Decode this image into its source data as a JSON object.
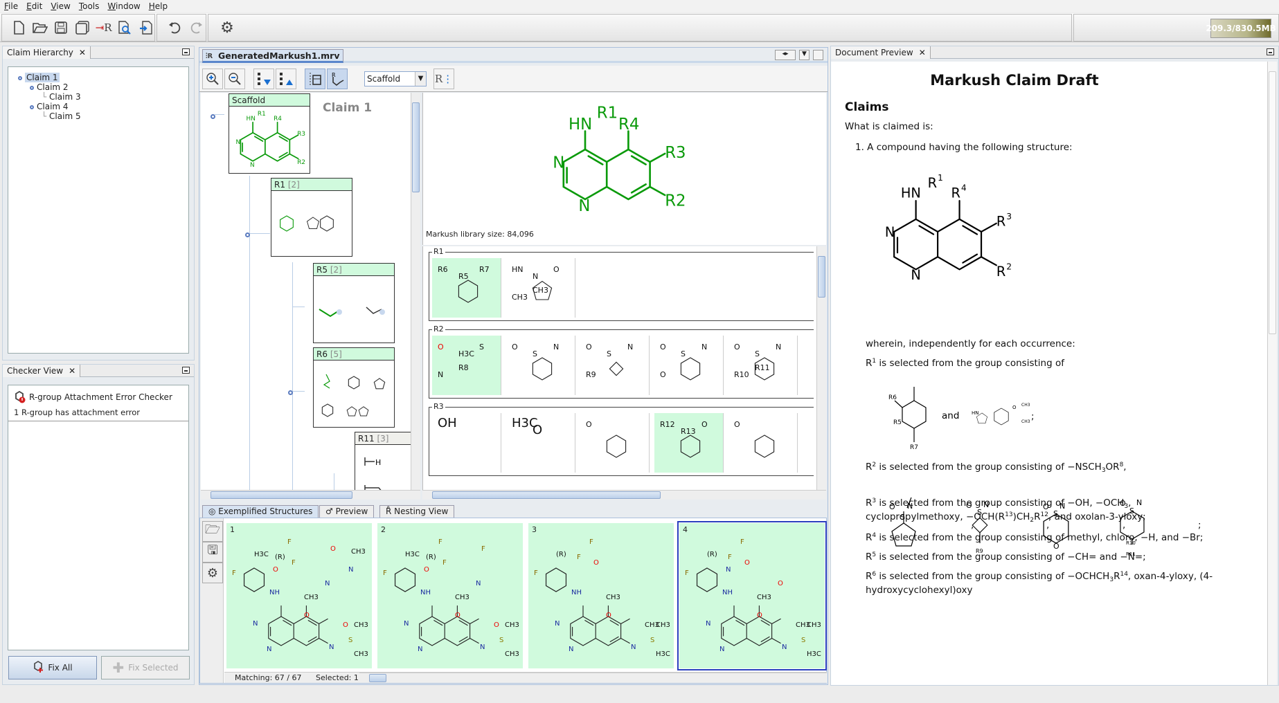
{
  "menu": [
    "File",
    "Edit",
    "View",
    "Tools",
    "Window",
    "Help"
  ],
  "toolbar": {
    "icons": [
      "new-file-icon",
      "open-folder-icon",
      "save-icon",
      "save-all-icon",
      "r-group-icon",
      "inspect-icon",
      "import-icon",
      "undo-icon",
      "redo-icon",
      "settings-icon"
    ],
    "r_group_glyph": "R",
    "memory": "209.3/830.5MB"
  },
  "claim_hierarchy": {
    "title": "Claim Hierarchy",
    "items": [
      {
        "label": "Claim 1",
        "level": 0,
        "selected": true
      },
      {
        "label": "Claim 2",
        "level": 1
      },
      {
        "label": "Claim 3",
        "level": 2
      },
      {
        "label": "Claim 4",
        "level": 1
      },
      {
        "label": "Claim 5",
        "level": 2
      }
    ]
  },
  "checker": {
    "title": "Checker View",
    "checker_name": "R-group Attachment Error Checker",
    "message": "1 R-group has attachment error",
    "fix_all": "Fix All",
    "fix_selected": "Fix Selected"
  },
  "editor": {
    "tab": "GeneratedMarkush1.mrv",
    "view_select": "Scaffold",
    "claim_label": "Claim 1",
    "library_size": "Markush library size: 84,096",
    "scaffold_labels": {
      "hn": "HN",
      "r1": "R1",
      "r4": "R4",
      "r3": "R3",
      "r2": "R2",
      "n1": "N",
      "n3": "N"
    },
    "tree_boxes": [
      {
        "title": "Scaffold",
        "count": ""
      },
      {
        "title": "R1",
        "count": "[2]"
      },
      {
        "title": "R5",
        "count": "[2]"
      },
      {
        "title": "R6",
        "count": "[5]"
      },
      {
        "title": "R11",
        "count": "[3]"
      }
    ],
    "rgroups": [
      {
        "label": "R1",
        "cells": [
          [
            "R6",
            "R5",
            "R7"
          ],
          [
            "HN",
            "N",
            "O",
            "CH3",
            "CH3"
          ]
        ]
      },
      {
        "label": "R2",
        "cells": [
          [
            "O",
            "H3C",
            "S",
            "N",
            "R8"
          ],
          [
            "O",
            "S",
            "N"
          ],
          [
            "O",
            "S",
            "N",
            "R9"
          ],
          [
            "O",
            "S",
            "N",
            "O"
          ],
          [
            "O",
            "S",
            "N",
            "R10",
            "R11"
          ]
        ]
      },
      {
        "label": "R3",
        "cells": [
          [
            "OH"
          ],
          [
            "H3C",
            "O"
          ],
          [
            "O"
          ],
          [
            "R12",
            "R13",
            "O"
          ],
          [
            "O"
          ]
        ]
      }
    ]
  },
  "bottom": {
    "tabs": [
      "Exemplified Structures",
      "Preview",
      "Nesting View"
    ],
    "active_tab": 0,
    "cards": [
      {
        "num": "1",
        "labels": [
          "F",
          "NH",
          "N",
          "N",
          "CH3",
          "O",
          "N",
          "S",
          "O",
          "CH3",
          "CH3",
          "H3C",
          "(R)",
          "F",
          "F",
          "O",
          "N",
          "O",
          "N",
          "CH3"
        ]
      },
      {
        "num": "2",
        "labels": [
          "F",
          "NH",
          "N",
          "N",
          "CH3",
          "O",
          "N",
          "S",
          "O",
          "CH3",
          "CH3",
          "H3C",
          "(R)",
          "F",
          "F",
          "O",
          "N",
          "F"
        ]
      },
      {
        "num": "3",
        "labels": [
          "F",
          "NH",
          "N",
          "N",
          "CH3",
          "O",
          "N",
          "S",
          "CH3",
          "CH3",
          "H3C",
          "(R)",
          "F",
          "F",
          "O"
        ]
      },
      {
        "num": "4",
        "labels": [
          "F",
          "NH",
          "N",
          "N",
          "CH3",
          "O",
          "N",
          "S",
          "CH3",
          "CH3",
          "H3C",
          "(R)",
          "F",
          "F",
          "O",
          "N",
          "O"
        ],
        "selected": true
      }
    ],
    "matching": "Matching: 67 / 67",
    "selected": "Selected: 1"
  },
  "document": {
    "title_tab": "Document Preview",
    "heading": "Markush Claim Draft",
    "section": "Claims",
    "intro": "What is claimed is:",
    "claim1": "1.  A compound having the following structure:",
    "structure_labels": {
      "hn": "HN",
      "r1": "R",
      "r1s": "1",
      "r4": "R",
      "r4s": "4",
      "r3": "R",
      "r3s": "3",
      "r2": "R",
      "r2s": "2",
      "n1": "N",
      "n3": "N"
    },
    "wherein": "wherein, independently for each occurrence:",
    "r1_and": "and",
    "paragraphs": [
      [
        {
          "t": "R"
        },
        {
          "sup": "1"
        },
        {
          "t": " is selected from the group consisting of"
        }
      ],
      [
        {
          "t": "R"
        },
        {
          "sup": "2"
        },
        {
          "t": " is selected from the group consisting of −NSCH"
        },
        {
          "sub": "3"
        },
        {
          "t": "OR"
        },
        {
          "sup": "8"
        },
        {
          "t": ","
        }
      ],
      [
        {
          "t": "R"
        },
        {
          "sup": "3"
        },
        {
          "t": " is selected from the group consisting of −OH, −OCH"
        },
        {
          "sub": "3"
        },
        {
          "t": ","
        }
      ],
      [
        {
          "t": "cyclopropylmethoxy, −OCH(R"
        },
        {
          "sup": "13"
        },
        {
          "t": ")CH"
        },
        {
          "sub": "2"
        },
        {
          "t": "R"
        },
        {
          "sup": "12"
        },
        {
          "t": ", and oxolan-3-yloxy;"
        }
      ],
      [
        {
          "t": "R"
        },
        {
          "sup": "4"
        },
        {
          "t": " is selected from the group consisting of methyl, chloro, −H, and −Br;"
        }
      ],
      [
        {
          "t": "R"
        },
        {
          "sup": "5"
        },
        {
          "t": " is selected from the group consisting of −CH= and −N=;"
        }
      ],
      [
        {
          "t": "R"
        },
        {
          "sup": "6"
        },
        {
          "t": " is selected from the group consisting of −OCHCH"
        },
        {
          "sub": "3"
        },
        {
          "t": "R"
        },
        {
          "sup": "14"
        },
        {
          "t": ", oxan-4-yloxy, (4-"
        }
      ],
      [
        {
          "t": "hydroxycyclohexyl)oxy"
        }
      ]
    ],
    "r2_separators": [
      ",",
      ",",
      ",",
      ";"
    ],
    "r1_terminator": ";",
    "mol_labels": {
      "r6": "R6",
      "r5": "R5",
      "r7": "R7",
      "hn": "HN",
      "n": "N",
      "o": "O",
      "ch3": "CH3",
      "s": "S",
      "r9": "R9",
      "r10": "R10",
      "r11": "R11"
    }
  },
  "colors": {
    "accent": "#5a7bbf",
    "scaffold_green": "#0a9a0a",
    "selected_bg": "#d0fadd",
    "error_red": "#d42020"
  }
}
